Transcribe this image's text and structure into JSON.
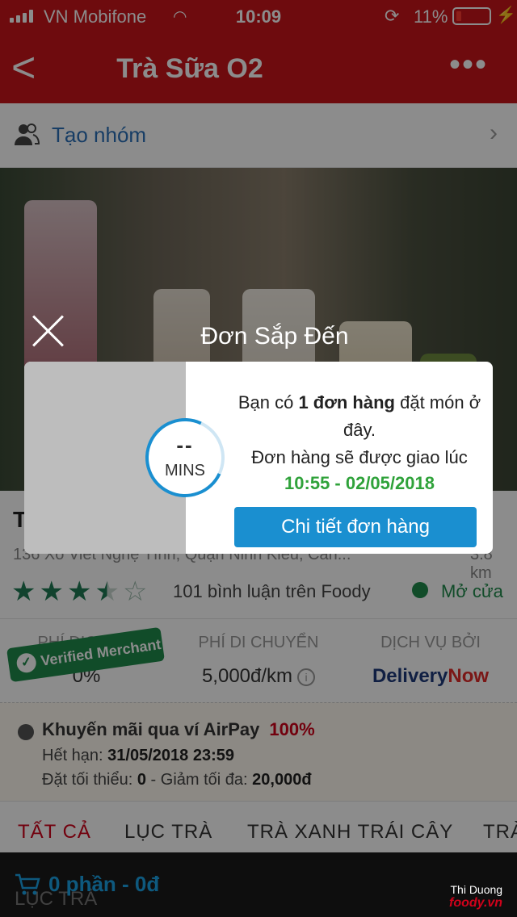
{
  "status_bar": {
    "carrier": "VN Mobifone",
    "time": "10:09",
    "battery_percent": "11%"
  },
  "nav": {
    "title": "Trà Sữa O2",
    "more": "•••"
  },
  "group_row": {
    "label": "Tạo nhóm"
  },
  "restaurant": {
    "name_visible": "T",
    "address": "136 Xô Viết Nghệ Tĩnh, Quận Ninh Kiều, Cần...",
    "distance": "3.8 km",
    "rating_stars": 3.5,
    "reviews": "101 bình luận trên Foody",
    "open_status": "Mở cửa"
  },
  "fees": {
    "service_fee_label": "PHÍ DỊCH VỤ",
    "service_fee_value": "0%",
    "delivery_fee_label": "PHÍ DI CHUYỂN",
    "delivery_fee_value": "5,000đ/km",
    "service_by_label": "DỊCH VỤ BỞI",
    "brand_part1": "Delivery",
    "brand_part2": "Now",
    "verified_badge": "Verified Merchant"
  },
  "promo": {
    "title": "Khuyến mãi qua ví AirPay",
    "percent": "100%",
    "expiry_label": "Hết hạn:",
    "expiry_value": "31/05/2018 23:59",
    "min_label": "Đặt tối thiểu:",
    "min_value": "0",
    "max_label": "- Giảm tối đa:",
    "max_value": "20,000đ"
  },
  "tabs": [
    "TẤT CẢ",
    "LỤC TRÀ",
    "TRÀ XANH TRÁI CÂY",
    "TRÀ"
  ],
  "bottom_bar": {
    "cart_text": "0 phần - 0đ",
    "behind_text": "LỤC TRÀ"
  },
  "watermark": {
    "author": "Thi Duong",
    "brand": "foody.vn"
  },
  "modal": {
    "title": "Đơn Sắp Đến",
    "timer_value": "--",
    "timer_unit": "MINS",
    "message_prefix": "Bạn có ",
    "message_bold": "1 đơn hàng",
    "message_suffix": " đặt món ở đây.",
    "delivery_note": "Đơn hàng sẽ được giao lúc",
    "delivery_time": "10:55 - 02/05/2018",
    "button_label": "Chi tiết đơn hàng"
  },
  "colors": {
    "brand_red": "#c8141b",
    "modal_button": "#1a8fd0",
    "time_green": "#2fa23a",
    "open_green": "#1f8a4c"
  },
  "icons": [
    "signal-icon",
    "wifi-icon",
    "rotation-lock-icon",
    "battery-icon",
    "bolt-icon",
    "back-icon",
    "more-icon",
    "group-icon",
    "chevron-right-icon",
    "star-icon",
    "info-icon",
    "promo-dot-icon",
    "cart-icon",
    "close-icon",
    "check-icon"
  ]
}
